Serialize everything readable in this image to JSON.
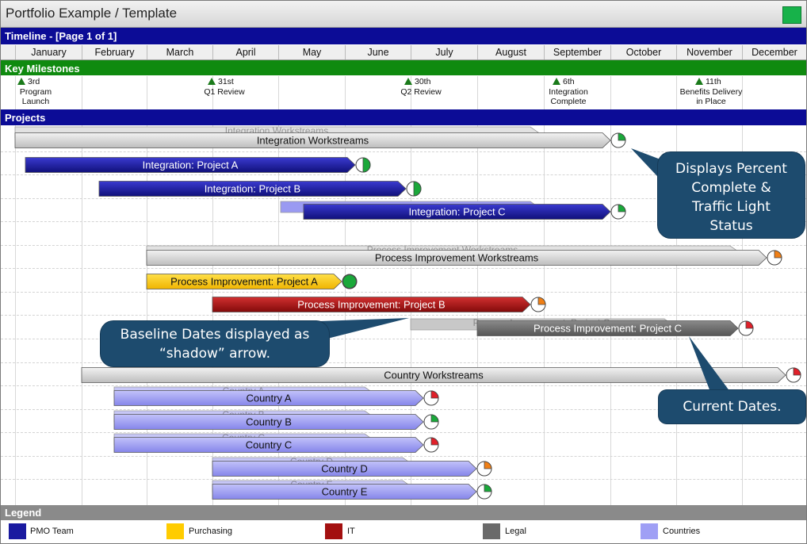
{
  "window": {
    "title": "Portfolio Example / Template",
    "status_color": "#17b24a"
  },
  "timeline_header": "Timeline - [Page 1 of 1]",
  "months": [
    "January",
    "February",
    "March",
    "April",
    "May",
    "June",
    "July",
    "August",
    "September",
    "October",
    "November",
    "December"
  ],
  "key_milestones": {
    "header": "Key Milestones",
    "items": [
      {
        "date": "3rd",
        "label_lines": [
          "Program",
          "Launch"
        ]
      },
      {
        "date": "31st",
        "label_lines": [
          "Q1 Review"
        ]
      },
      {
        "date": "30th",
        "label_lines": [
          "Q2 Review"
        ]
      },
      {
        "date": "6th",
        "label_lines": [
          "Integration",
          "Complete"
        ]
      },
      {
        "date": "11th",
        "label_lines": [
          "Benefits Delivery",
          "in Place"
        ]
      }
    ]
  },
  "projects_header": "Projects",
  "colors": {
    "pmo": "#1a1aa0",
    "purchasing": "#ffcc00",
    "it": "#a31010",
    "legal": "#6a6a6a",
    "countries": "#9f9ff5",
    "workstream": "#d4d4d4",
    "green": "#1aa83a",
    "red": "#e0202a",
    "orange": "#f07f15"
  },
  "projects": [
    {
      "label": "Integration Workstreams",
      "kind": "workstream",
      "status": "green",
      "percent": 25,
      "baseline_label": "Integration Workstreams"
    },
    {
      "label": "Integration: Project A",
      "kind": "pmo",
      "status": "green",
      "percent": 50
    },
    {
      "label": "Integration: Project B",
      "kind": "pmo",
      "status": "green",
      "percent": 50
    },
    {
      "label": "Integration: Project C",
      "kind": "pmo",
      "status": "green",
      "percent": 25
    },
    {
      "label": "Process Improvement Workstreams",
      "kind": "workstream",
      "status": "orange",
      "percent": 25,
      "baseline_label": "Process Improvement Workstreams"
    },
    {
      "label": "Process Improvement: Project A",
      "kind": "purchasing",
      "status": "green",
      "percent": 100
    },
    {
      "label": "Process Improvement: Project B",
      "kind": "it",
      "status": "orange",
      "percent": 25
    },
    {
      "label": "Process Improvement: Project C",
      "kind": "legal",
      "status": "red",
      "percent": 25,
      "baseline_label": "Process Improvement: Project C"
    },
    {
      "label": "Country Workstreams",
      "kind": "workstream",
      "status": "red",
      "percent": 25
    },
    {
      "label": "Country A",
      "kind": "countries",
      "status": "red",
      "percent": 25,
      "baseline_label": "Country A"
    },
    {
      "label": "Country B",
      "kind": "countries",
      "status": "green",
      "percent": 25,
      "baseline_label": "Country B"
    },
    {
      "label": "Country C",
      "kind": "countries",
      "status": "red",
      "percent": 25,
      "baseline_label": "Country C"
    },
    {
      "label": "Country D",
      "kind": "countries",
      "status": "orange",
      "percent": 25,
      "baseline_label": "Country D"
    },
    {
      "label": "Country E",
      "kind": "countries",
      "status": "green",
      "percent": 25,
      "baseline_label": "Country E"
    }
  ],
  "callouts": {
    "percent": [
      "Displays Percent",
      "Complete &",
      "Traffic Light",
      "Status"
    ],
    "baseline": [
      "Baseline Dates displayed as",
      "“shadow” arrow."
    ],
    "current": "Current Dates."
  },
  "legend": {
    "header": "Legend",
    "items": [
      {
        "label": "PMO Team",
        "color": "#1a1aa0"
      },
      {
        "label": "Purchasing",
        "color": "#ffcc00"
      },
      {
        "label": "IT",
        "color": "#a31010"
      },
      {
        "label": "Legal",
        "color": "#6a6a6a"
      },
      {
        "label": "Countries",
        "color": "#9f9ff5"
      }
    ]
  }
}
